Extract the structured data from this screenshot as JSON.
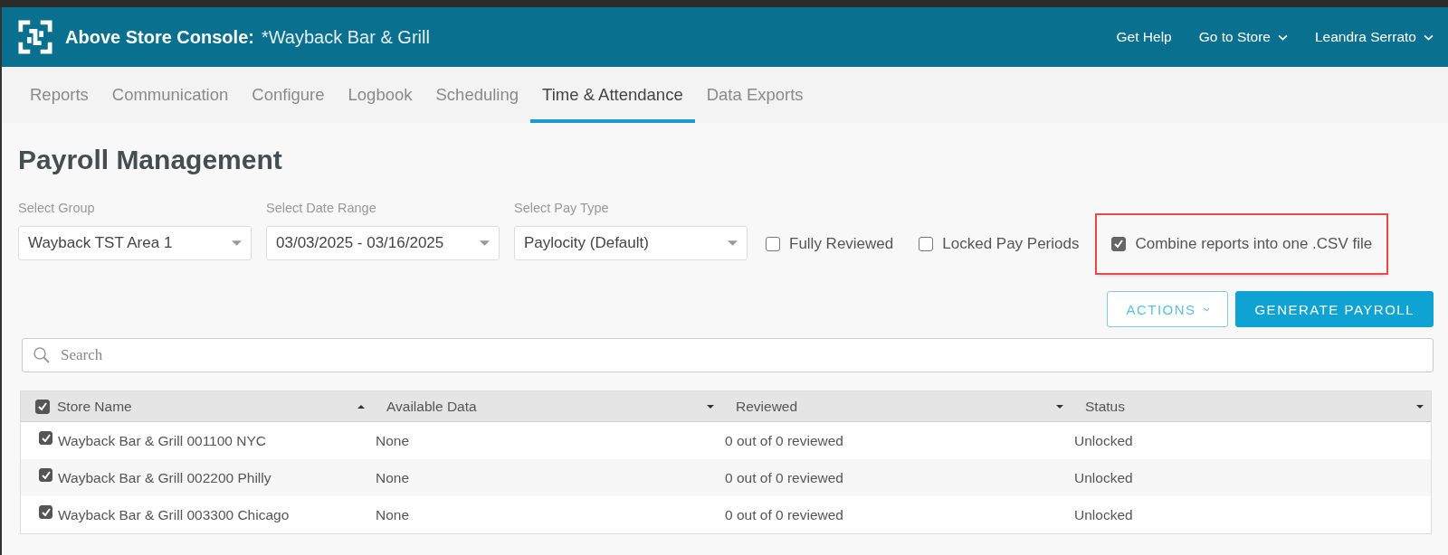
{
  "header": {
    "app_name": "Above Store Console:",
    "store_name": "*Wayback Bar & Grill",
    "links": [
      {
        "label": "Get Help",
        "dropdown": false
      },
      {
        "label": "Go to Store",
        "dropdown": true
      },
      {
        "label": "Leandra Serrato",
        "dropdown": true
      }
    ]
  },
  "tabs": [
    {
      "label": "Reports",
      "selected": false
    },
    {
      "label": "Communication",
      "selected": false
    },
    {
      "label": "Configure",
      "selected": false
    },
    {
      "label": "Logbook",
      "selected": false
    },
    {
      "label": "Scheduling",
      "selected": false
    },
    {
      "label": "Time & Attendance",
      "selected": true
    },
    {
      "label": "Data Exports",
      "selected": false
    }
  ],
  "page_title": "Payroll Management",
  "filters": [
    {
      "label": "Select Group",
      "value": "Wayback TST Area 1"
    },
    {
      "label": "Select Date Range",
      "value": "03/03/2025 - 03/16/2025"
    },
    {
      "label": "Select Pay Type",
      "value": "Paylocity (Default)"
    }
  ],
  "options": [
    {
      "label": "Fully Reviewed",
      "checked": false,
      "highlighted": false
    },
    {
      "label": "Locked Pay Periods",
      "checked": false,
      "highlighted": false
    },
    {
      "label": "Combine reports into one .CSV file",
      "checked": true,
      "highlighted": true
    }
  ],
  "buttons": [
    {
      "label": "ACTIONS",
      "kind": "outline"
    },
    {
      "label": "GENERATE PAYROLL",
      "kind": "primary"
    }
  ],
  "search": {
    "placeholder": "Search"
  },
  "table": {
    "select_all": true,
    "columns": [
      {
        "label": "Store Name",
        "sorted": true
      },
      {
        "label": "Available Data",
        "sorted": false
      },
      {
        "label": "Reviewed",
        "sorted": false
      },
      {
        "label": "Status",
        "sorted": false
      }
    ],
    "rows": [
      {
        "checked": true,
        "cells": [
          "Wayback Bar & Grill 001100 NYC",
          "None",
          "0 out of 0 reviewed",
          "Unlocked"
        ]
      },
      {
        "checked": true,
        "cells": [
          "Wayback Bar & Grill 002200 Philly",
          "None",
          "0 out of 0 reviewed",
          "Unlocked"
        ]
      },
      {
        "checked": true,
        "cells": [
          "Wayback Bar & Grill 003300 Chicago",
          "None",
          "0 out of 0 reviewed",
          "Unlocked"
        ]
      }
    ]
  }
}
